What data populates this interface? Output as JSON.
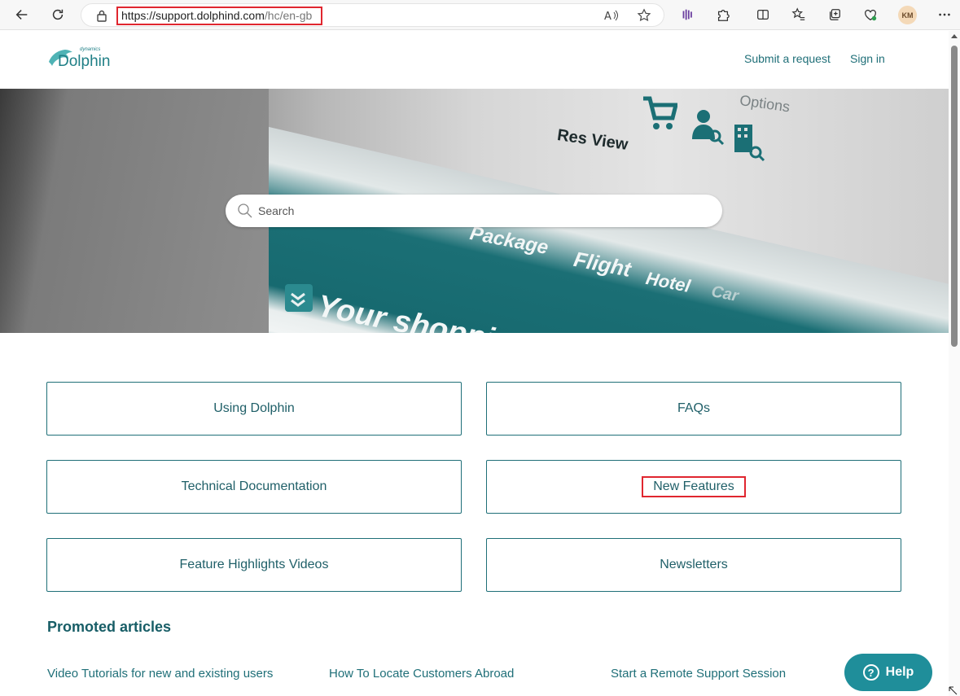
{
  "browser": {
    "url_host": "https://support.dolphind.com",
    "url_path": "/hc/en-gb",
    "profile_initials": "KM",
    "icons": [
      "back-icon",
      "refresh-icon",
      "lock-icon",
      "read-aloud-icon",
      "favorite-star-icon",
      "extension-purple-icon",
      "extensions-puzzle-icon",
      "split-screen-icon",
      "favorites-icon",
      "collections-icon",
      "browser-essentials-icon",
      "more-menu-icon"
    ]
  },
  "header": {
    "logo_text": "Dolphin",
    "logo_subtext": "dynamics",
    "submit_request": "Submit a request",
    "sign_in": "Sign in"
  },
  "hero": {
    "image_text": {
      "res_view": "Res View",
      "options": "Options",
      "package": "Package",
      "flight": "Flight",
      "hotel": "Hotel",
      "car": "Car",
      "shopping": "Your shopping"
    }
  },
  "search": {
    "placeholder": "Search"
  },
  "categories": [
    {
      "label": "Using Dolphin"
    },
    {
      "label": "FAQs"
    },
    {
      "label": "Technical Documentation"
    },
    {
      "label": "New Features"
    },
    {
      "label": "Feature Highlights Videos"
    },
    {
      "label": "Newsletters"
    }
  ],
  "promoted": {
    "title": "Promoted articles",
    "articles": [
      {
        "label": "Video Tutorials for new and existing users"
      },
      {
        "label": "How To Locate Customers Abroad"
      },
      {
        "label": "Start a Remote Support Session"
      }
    ]
  },
  "help": {
    "label": "Help"
  },
  "colors": {
    "brand": "#1f6f78",
    "highlight": "#e0262f",
    "help_button": "#1f8e9a"
  }
}
